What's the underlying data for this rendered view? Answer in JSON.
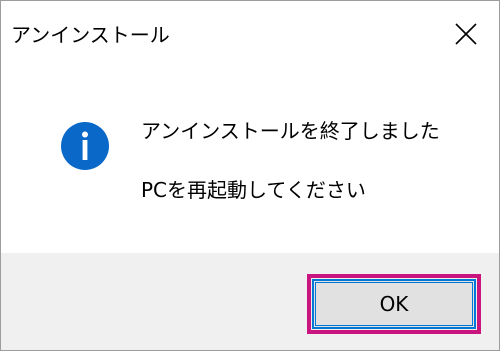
{
  "dialog": {
    "title": "アンインストール",
    "close_icon": "close-icon",
    "message_icon": "info-icon",
    "message_line1": "アンインストールを終了しました",
    "message_line2": "PCを再起動してください",
    "ok_label": "OK"
  },
  "colors": {
    "info_blue": "#0a68c9",
    "button_focus": "#0078d7",
    "highlight": "#c9157f",
    "footer_bg": "#f0f0f0"
  }
}
